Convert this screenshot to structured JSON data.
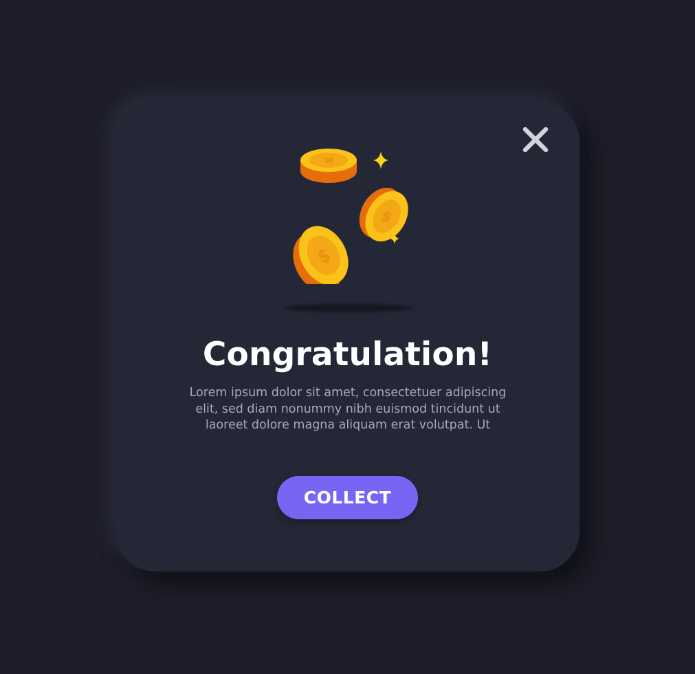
{
  "modal": {
    "title": "Congratulation!",
    "body_lines": [
      "Lorem ipsum dolor sit amet, consectetuer adipiscing",
      "elit, sed diam nonummy nibh euismod tincidunt ut",
      "laoreet dolore magna aliquam erat volutpat. Ut"
    ],
    "collect_label": "COLLECT",
    "close_icon": "close-icon",
    "illustration_icon": "coins-icon"
  },
  "colors": {
    "background": "#1e1e2a",
    "card": "#242736",
    "accent": "#7766f4",
    "coin_face": "#fbc21a",
    "coin_edge": "#e66d0c",
    "sparkle": "#ffd21c"
  }
}
